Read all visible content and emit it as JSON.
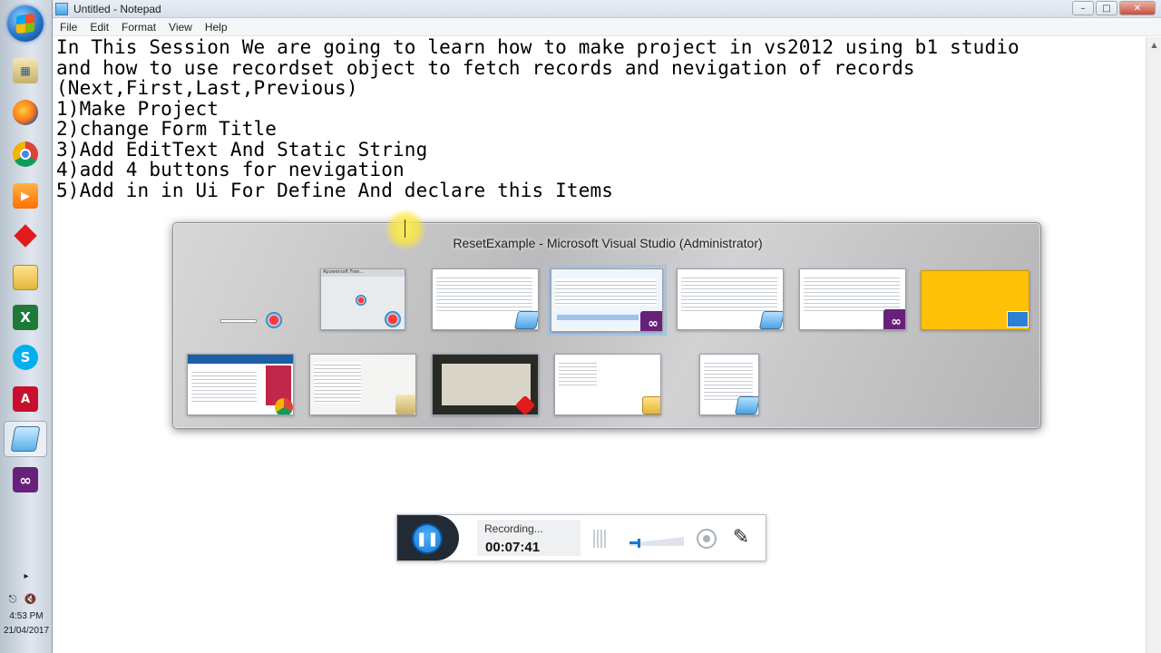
{
  "window": {
    "title": "Untitled - Notepad",
    "controls": {
      "minimize": "–",
      "maximize": "□",
      "close": "✕"
    }
  },
  "menu": [
    "File",
    "Edit",
    "Format",
    "View",
    "Help"
  ],
  "editor": {
    "lines": [
      "In This Session We are going to learn how to make project in vs2012 using b1 studio",
      "and how to use recordset object to fetch records and nevigation of records",
      "(Next,First,Last,Previous)",
      "1)Make Project",
      "2)change Form Title",
      "3)Add EditText And Static String",
      "4)add 4 buttons for nevigation",
      "5)Add in in Ui For Define And declare this Items"
    ]
  },
  "alttab": {
    "title": "ResetExample - Microsoft Visual Studio (Administrator)",
    "thumbs_row1": [
      {
        "app": "Desktop",
        "badge": "recorder"
      },
      {
        "app": "Recorder",
        "badge": "recorder",
        "mini_title": "Apowersoft Free..."
      },
      {
        "app": "Notepad",
        "badge": "notepad"
      },
      {
        "app": "Visual Studio",
        "badge": "visual-studio",
        "selected": true
      },
      {
        "app": "Notepad",
        "badge": "notepad"
      },
      {
        "app": "Visual Studio",
        "badge": "visual-studio"
      },
      {
        "app": "Desktop wallpaper",
        "badge": "monitor"
      }
    ],
    "thumbs_row2": [
      {
        "app": "Chrome",
        "badge": "chrome"
      },
      {
        "app": "SAP Business One",
        "badge": "sap"
      },
      {
        "app": "Video player",
        "badge": "red-diamond"
      },
      {
        "app": "Explorer",
        "badge": "folder"
      },
      {
        "app": "Notepad",
        "badge": "notepad"
      }
    ]
  },
  "recorder": {
    "status": "Recording...",
    "time": "00:07:41",
    "pause_icon": "❚❚",
    "volume_fraction": 0.2,
    "pen_icon": "✎"
  },
  "taskbar": {
    "apps": [
      "windows-start",
      "sap-business-one",
      "firefox",
      "chrome",
      "media-player",
      "red-diamond-app",
      "file-explorer",
      "excel",
      "skype",
      "acrobat",
      "notepad",
      "visual-studio"
    ],
    "active": "notepad",
    "tray_arrow": "▸",
    "clock_time": "4:53 PM",
    "clock_date": "21/04/2017"
  },
  "colors": {
    "vs_purple": "#68217a",
    "chrome_red": "#db4437",
    "accent_blue": "#1577d6",
    "wallpaper_yellow": "#ffc107"
  }
}
